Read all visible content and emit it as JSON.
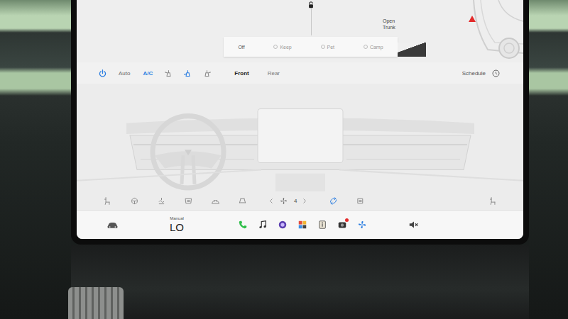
{
  "vehicle": {
    "locked": false,
    "alert": true,
    "trunk": {
      "label": "Open Trunk"
    }
  },
  "keep_modes": [
    {
      "label": "Off",
      "selected": true
    },
    {
      "label": "Keep",
      "selected": false
    },
    {
      "label": "Pet",
      "selected": false
    },
    {
      "label": "Camp",
      "selected": false
    }
  ],
  "climate": {
    "power": {
      "on": true
    },
    "auto": {
      "label": "Auto",
      "on": false
    },
    "ac": {
      "label": "A/C",
      "on": true
    },
    "airflow": [
      {
        "on": false
      },
      {
        "on": true
      },
      {
        "on": false
      }
    ],
    "zones": [
      {
        "label": "Front",
        "selected": true
      },
      {
        "label": "Rear",
        "selected": false
      }
    ],
    "schedule": {
      "label": "Schedule"
    }
  },
  "controls": {
    "left": [
      {
        "on": false
      },
      {
        "on": false
      },
      {
        "on": false
      },
      {
        "on": false
      },
      {
        "on": false
      },
      {
        "on": false
      }
    ],
    "fan": {
      "speed": "4"
    },
    "right": [
      {
        "on": true
      },
      {
        "on": false
      }
    ],
    "seat_right": {
      "on": false
    }
  },
  "dock": {
    "temperature": {
      "mode": "Manual",
      "value": "LO"
    },
    "apps": [
      {
        "badge": false
      },
      {
        "badge": false
      },
      {
        "badge": false
      },
      {
        "badge": false
      },
      {
        "badge": false
      },
      {
        "badge": true
      },
      {
        "badge": false
      }
    ],
    "volume": {
      "muted": true
    }
  }
}
